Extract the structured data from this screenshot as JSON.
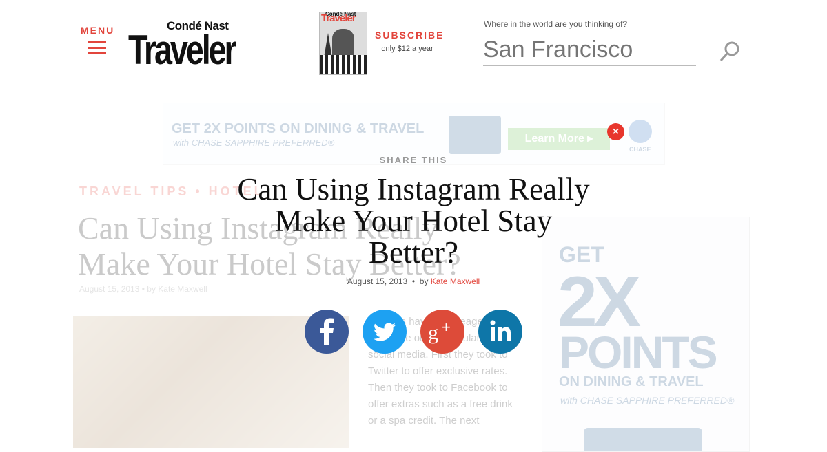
{
  "header": {
    "menu_label": "MENU",
    "logo_top": "Condé Nast",
    "logo_main": "Traveler",
    "magazine": {
      "masthead": "Traveler",
      "top": "Condé Nast"
    },
    "subscribe_label": "SUBSCRIBE",
    "subscribe_price": "only $12 a year",
    "search": {
      "label": "Where in the world are you thinking of?",
      "placeholder": "San Francisco"
    },
    "icons": {
      "menu": "hamburger-icon",
      "search": "search-icon"
    }
  },
  "ad_banner": {
    "headline": "GET 2X POINTS ON DINING & TRAVEL",
    "subline": "with CHASE SAPPHIRE PREFERRED®",
    "cta": "Learn More ▸",
    "brand": "CHASE",
    "close_glyph": "×"
  },
  "background_article": {
    "crumbs": "TRAVEL TIPS  •  HOTEL",
    "headline": "Can Using Instagram Really Make Your Hotel Stay Better?",
    "byline": "August 15, 2013  •  by Kate Maxwell",
    "body": "…hotels have been eager to capitalize on the popularity of social media. First they took to Twitter to offer exclusive rates. Then they took to Facebook to offer extras such as a free drink or a spa credit. The next"
  },
  "side_ad": {
    "line1": "GET",
    "line2": "2X",
    "line3": "POINTS",
    "line4": "ON DINING & TRAVEL",
    "line5": "with CHASE SAPPHIRE PREFERRED®"
  },
  "share_overlay": {
    "heading": "SHARE THIS",
    "title": "Can Using Instagram Really Make Your Hotel Stay Better?",
    "date": "August 15, 2013",
    "separator": "•",
    "by": "by",
    "author": "Kate Maxwell",
    "buttons": [
      {
        "name": "facebook",
        "icon": "facebook-icon",
        "color": "#3b5998"
      },
      {
        "name": "twitter",
        "icon": "twitter-icon",
        "color": "#1da1f2"
      },
      {
        "name": "google-plus",
        "icon": "google-plus-icon",
        "color": "#dd4b39"
      },
      {
        "name": "linkedin",
        "icon": "linkedin-icon",
        "color": "#0e76a8"
      }
    ]
  },
  "colors": {
    "accent": "#e2453c",
    "chase_blue": "#1b4d82"
  }
}
